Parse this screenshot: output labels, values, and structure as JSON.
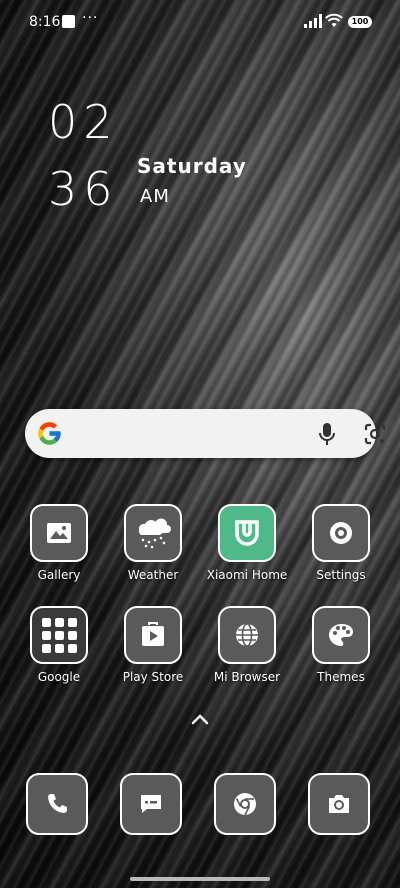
{
  "status_bar": {
    "time": "8:16",
    "dots": "···",
    "battery": "100"
  },
  "clock": {
    "hour": "02",
    "minute": "36",
    "day": "Saturday",
    "ampm": "AM"
  },
  "search": {
    "placeholder": ""
  },
  "apps_row1": [
    {
      "label": "Gallery",
      "icon": "gallery-icon"
    },
    {
      "label": "Weather",
      "icon": "weather-icon"
    },
    {
      "label": "Xiaomi Home",
      "icon": "xiaomi-home-icon"
    },
    {
      "label": "Settings",
      "icon": "settings-icon"
    }
  ],
  "apps_row2": [
    {
      "label": "Google",
      "icon": "google-folder-icon"
    },
    {
      "label": "Play Store",
      "icon": "play-store-icon"
    },
    {
      "label": "Mi Browser",
      "icon": "mi-browser-icon"
    },
    {
      "label": "Themes",
      "icon": "themes-icon"
    }
  ],
  "dock": [
    {
      "icon": "phone-icon"
    },
    {
      "icon": "messages-icon"
    },
    {
      "icon": "chrome-icon"
    },
    {
      "icon": "camera-icon"
    }
  ],
  "colors": {
    "icon_bg": "#5a5a5a",
    "mihome_bg": "#4fb98a",
    "search_bg": "#f2f2f2"
  }
}
